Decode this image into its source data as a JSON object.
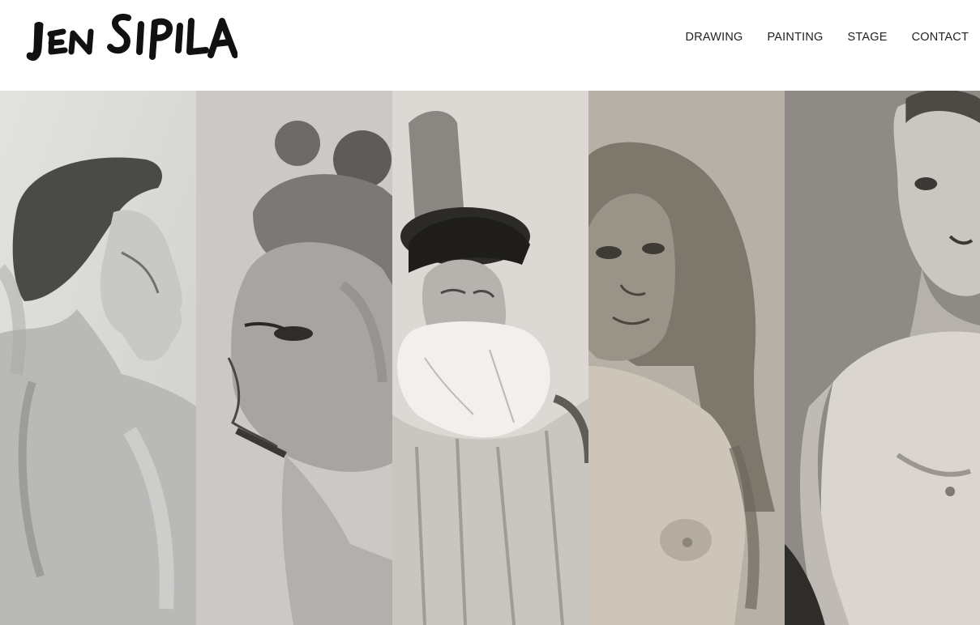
{
  "site": {
    "logo_text": "JEN SIPILA"
  },
  "nav": {
    "items": [
      {
        "label": "DRAWING"
      },
      {
        "label": "PAINTING"
      },
      {
        "label": "STAGE"
      },
      {
        "label": "CONTACT"
      }
    ]
  },
  "gallery": {
    "panels": [
      {
        "subject": "young man in profile, bare shoulders",
        "tone": "#d7d7d5"
      },
      {
        "subject": "woman with hair in knots, profile",
        "tone": "#c9c6c5"
      },
      {
        "subject": "bearded man in dark hat",
        "tone": "#d9d6d1"
      },
      {
        "subject": "woman with long hair",
        "tone": "#b9b3a9"
      },
      {
        "subject": "standing nude man",
        "tone": "#9d9994"
      }
    ]
  }
}
